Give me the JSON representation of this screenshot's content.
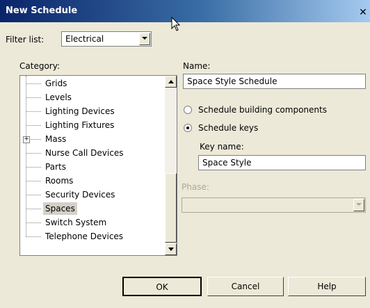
{
  "window": {
    "title": "New Schedule",
    "close_glyph": "✕"
  },
  "filter": {
    "label": "Filter list:",
    "value": "Electrical"
  },
  "category": {
    "label": "Category:",
    "items": [
      {
        "label": "Grids",
        "expandable": false,
        "selected": false
      },
      {
        "label": "Levels",
        "expandable": false,
        "selected": false
      },
      {
        "label": "Lighting Devices",
        "expandable": false,
        "selected": false
      },
      {
        "label": "Lighting Fixtures",
        "expandable": false,
        "selected": false
      },
      {
        "label": "Mass",
        "expandable": true,
        "selected": false
      },
      {
        "label": "Nurse Call Devices",
        "expandable": false,
        "selected": false
      },
      {
        "label": "Parts",
        "expandable": false,
        "selected": false
      },
      {
        "label": "Rooms",
        "expandable": false,
        "selected": false
      },
      {
        "label": "Security Devices",
        "expandable": false,
        "selected": false
      },
      {
        "label": "Spaces",
        "expandable": false,
        "selected": true
      },
      {
        "label": "Switch System",
        "expandable": false,
        "selected": false
      },
      {
        "label": "Telephone Devices",
        "expandable": false,
        "selected": false
      }
    ]
  },
  "name": {
    "label": "Name:",
    "value": "Space Style Schedule"
  },
  "options": {
    "building_components": {
      "label": "Schedule building components",
      "checked": false
    },
    "schedule_keys": {
      "label": "Schedule keys",
      "checked": true
    }
  },
  "key_name": {
    "label": "Key name:",
    "value": "Space Style"
  },
  "phase": {
    "label": "Phase:",
    "value": "",
    "disabled": true
  },
  "buttons": {
    "ok": "OK",
    "cancel": "Cancel",
    "help": "Help"
  },
  "icons": {
    "close": "close-icon",
    "cursor": "mouse-pointer-icon",
    "expander": "plus-expander-icon"
  }
}
